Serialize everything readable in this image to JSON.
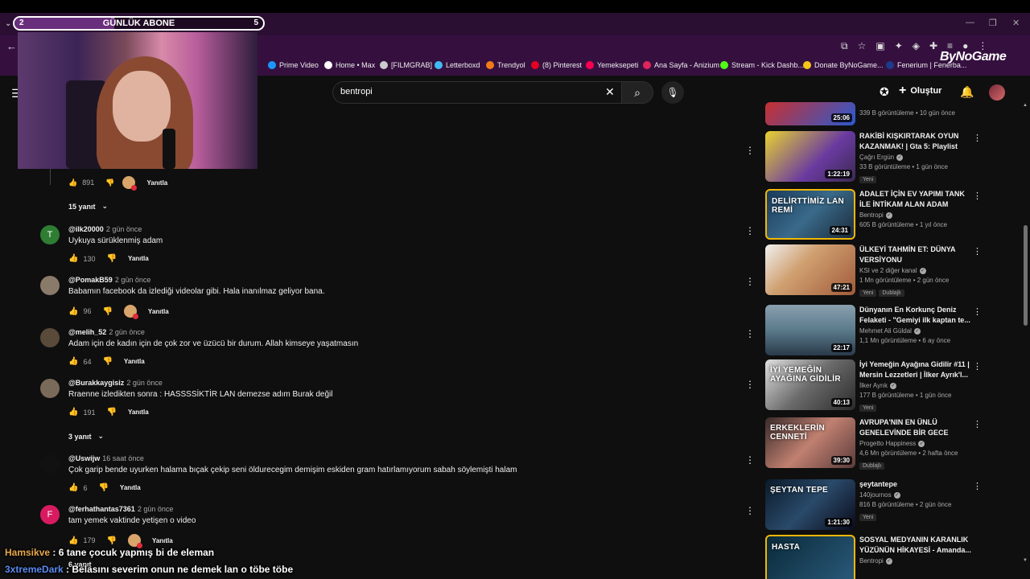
{
  "overlay": {
    "sub_goal": {
      "label": "GÜNLÜK ABONE",
      "current": "2",
      "target": "5",
      "progress": 0.4
    },
    "brand": "ByNoGame"
  },
  "bookmarks": [
    {
      "label": "Prime Video",
      "color": "#1a98ff"
    },
    {
      "label": "Home • Max",
      "color": "#ffffff"
    },
    {
      "label": "[FILMGRAB]",
      "color": "#cccccc"
    },
    {
      "label": "Letterboxd",
      "color": "#40bcf4"
    },
    {
      "label": "Trendyol",
      "color": "#f27a1a"
    },
    {
      "label": "(8) Pinterest",
      "color": "#e60023"
    },
    {
      "label": "Yemeksepeti",
      "color": "#fa0050"
    },
    {
      "label": "Ana Sayfa - Anizium",
      "color": "#e0245e"
    },
    {
      "label": "Stream - Kick Dashb...",
      "color": "#53fc18"
    },
    {
      "label": "Donate ByNoGame...",
      "color": "#f5c518"
    },
    {
      "label": "Fenerium | Fenerba...",
      "color": "#1e3a8a"
    }
  ],
  "header": {
    "search_value": "bentropi",
    "create_label": "Oluştur"
  },
  "comments_top": {
    "likes": "891",
    "reply_label": "Yanıtla",
    "replies_toggle": "15 yanıt"
  },
  "comments": [
    {
      "author": "@ilk20000",
      "time": "2 gün önce",
      "text": "Uykuya sürüklenmiş adam",
      "likes": "130",
      "reply": "Yanıtla",
      "avatar_letter": "T",
      "avatar_color": "#2e7d32",
      "hearted": false
    },
    {
      "author": "@PomakB59",
      "time": "2 gün önce",
      "text": "Babamın facebook da izlediği videolar gibi. Hala inanılmaz geliyor bana.",
      "likes": "96",
      "reply": "Yanıtla",
      "avatar_letter": "",
      "avatar_color": "#8a7a6a",
      "hearted": true
    },
    {
      "author": "@melih_52",
      "time": "2 gün önce",
      "text": "Adam için de kadın için de çok zor ve üzücü bir durum. Allah kimseye yaşatmasın",
      "likes": "64",
      "reply": "Yanıtla",
      "avatar_letter": "",
      "avatar_color": "#5a4a3a",
      "hearted": false
    },
    {
      "author": "@Burakkaygisiz",
      "time": "2 gün önce",
      "text": "Rraenne izledikten sonra : HASSSSİKTİR LAN demezse adım Burak değil",
      "likes": "191",
      "reply": "Yanıtla",
      "avatar_letter": "",
      "avatar_color": "#7a6a5a",
      "hearted": false
    },
    {
      "author": "@Uswijw",
      "time": "16 saat önce",
      "text": "Çok garip bende uyurken halama bıçak çekip seni öldurecegim demişim eskiden gram hatırlamıyorum sabah söylemişti halam",
      "likes": "6",
      "reply": "Yanıtla",
      "avatar_letter": "",
      "avatar_color": "#111111",
      "hearted": false
    },
    {
      "author": "@ferhathantas7361",
      "time": "2 gün önce",
      "text": "tam yemek vaktinde yetişen o video",
      "likes": "179",
      "reply": "Yanıtla",
      "avatar_letter": "F",
      "avatar_color": "#d81b60",
      "hearted": true
    }
  ],
  "replies_toggle_2": "3 yanıt",
  "replies_toggle_3": "6 yanıt",
  "sidebar": [
    {
      "title": "",
      "channel": "",
      "meta": "339 B görüntüleme • 10 gün önce",
      "duration": "25:06",
      "badges": [],
      "thumb_bg": "linear-gradient(135deg,#c83030,#2a5ad0)",
      "thumb_text": ""
    },
    {
      "title": "RAKİBİ KIŞKIRTARAK OYUN KAZANMAK! | Gta 5: Playlist",
      "channel": "Çağrı Ergün",
      "meta": "33 B görüntüleme • 1 gün önce",
      "duration": "1:22:19",
      "badges": [
        "Yeni"
      ],
      "thumb_bg": "linear-gradient(135deg,#e8d230,#6a3aa0 60%,#3a2a50)",
      "thumb_text": ""
    },
    {
      "title": "ADALET İÇİN EV YAPIMI TANK İLE İNTİKAM ALAN ADAM",
      "channel": "Bentropi",
      "meta": "605 B görüntüleme • 1 yıl önce",
      "duration": "24:31",
      "badges": [],
      "thumb_bg": "linear-gradient(135deg,#1a3a5a,#3a6a8a 50%,#1a2a3a)",
      "thumb_text": "DELİRTTİMİZ LAN REMİ"
    },
    {
      "title": "ÜLKEYİ TAHMİN ET: DÜNYA VERSİYONU",
      "channel": "KSI ve 2 diğer kanal",
      "meta": "1 Mn görüntüleme • 2 gün önce",
      "duration": "47:21",
      "badges": [
        "Yeni",
        "Dublajlı"
      ],
      "thumb_bg": "linear-gradient(135deg,#f0f0f0,#d0a070 40%,#a05a3a)",
      "thumb_text": ""
    },
    {
      "title": "Dünyanın En Korkunç Deniz Felaketi - \"Gemiyi ilk kaptan te...",
      "channel": "Mehmet Ali Güldal",
      "meta": "1,1 Mn görüntüleme • 6 ay önce",
      "duration": "22:17",
      "badges": [],
      "thumb_bg": "linear-gradient(180deg,#8aa0b0,#5a7a8a 50%,#2a3a4a)",
      "thumb_text": ""
    },
    {
      "title": "İyi Yemeğin Ayağına Gidilir #11 | Mersin Lezzetleri | İlker Ayrık'l...",
      "channel": "İlker Ayrık",
      "meta": "177 B görüntüleme • 1 gün önce",
      "duration": "40:13",
      "badges": [
        "Yeni"
      ],
      "thumb_bg": "linear-gradient(135deg,#e0e0e0,#6a6a6a 50%,#2a2a2a)",
      "thumb_text": "İYİ YEMEĞİN AYAĞINA GİDİLİR"
    },
    {
      "title": "AVRUPA'NIN EN ÜNLÜ GENELEVİNDE BİR GECE",
      "channel": "Progetto Happiness",
      "meta": "4,6 Mn görüntüleme • 2 hafta önce",
      "duration": "39:30",
      "badges": [
        "Dublajlı"
      ],
      "thumb_bg": "linear-gradient(135deg,#3a2a2a,#c08070 50%,#5a3a3a)",
      "thumb_text": "ERKEKLERİN CENNETİ"
    },
    {
      "title": "şeytantepe",
      "channel": "140journos",
      "meta": "816 B görüntüleme • 2 gün önce",
      "duration": "1:21:30",
      "badges": [
        "Yeni"
      ],
      "thumb_bg": "linear-gradient(135deg,#0a1a2a,#2a4a6a 50%,#0a0a1a)",
      "thumb_text": "ŞEYTAN TEPE"
    },
    {
      "title": "SOSYAL MEDYANIN KARANLIK YÜZÜNÜN HİKAYESİ - Amanda...",
      "channel": "Bentropi",
      "meta": "",
      "duration": "",
      "badges": [],
      "thumb_bg": "linear-gradient(135deg,#0a2a3a,#2a5a7a)",
      "thumb_text": "HASTA"
    }
  ],
  "chat": [
    {
      "name": "Hamsikve",
      "message": "6 tane çocuk yapmış bi de eleman"
    },
    {
      "name": "3xtremeDark",
      "message": "Belasını severim onun ne demek lan o töbe töbe"
    }
  ]
}
